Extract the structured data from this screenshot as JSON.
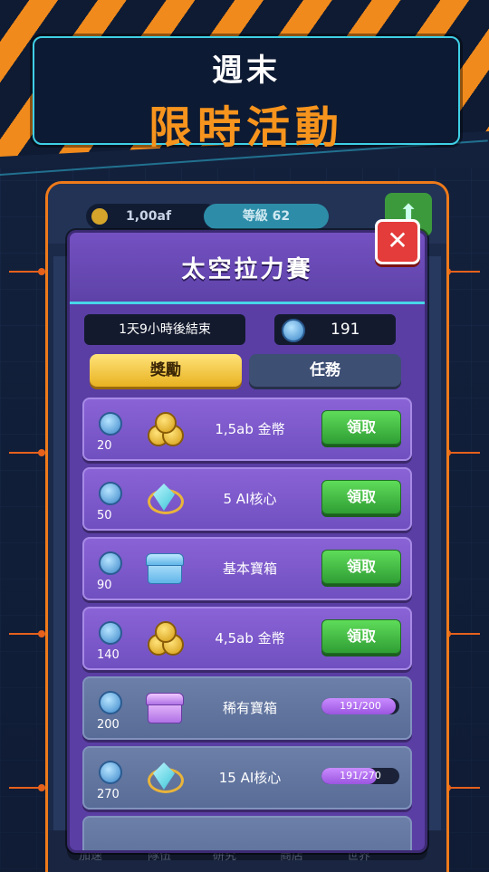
{
  "banner": {
    "line1": "週末",
    "line2": "限時活動"
  },
  "game": {
    "currency": "1,00af",
    "level": "等級 62",
    "nav": [
      "加速",
      "隊伍",
      "研究",
      "商店",
      "世界"
    ]
  },
  "dialog": {
    "title": "太空拉力賽",
    "close_label": "✕",
    "timer": "1天9小時後結束",
    "points": "191",
    "tabs": {
      "rewards": "獎勵",
      "tasks": "任務"
    },
    "rows": [
      {
        "points": "20",
        "label": "1,5ab 金幣",
        "icon": "coins-icon",
        "state": "claim",
        "button": "領取"
      },
      {
        "points": "50",
        "label": "5 AI核心",
        "icon": "gem-icon",
        "state": "claim",
        "button": "領取"
      },
      {
        "points": "90",
        "label": "基本寶箱",
        "icon": "blue-chest-icon",
        "state": "claim",
        "button": "領取"
      },
      {
        "points": "140",
        "label": "4,5ab 金幣",
        "icon": "coins-icon",
        "state": "claim",
        "button": "領取"
      },
      {
        "points": "200",
        "label": "稀有寶箱",
        "icon": "purple-chest-icon",
        "state": "progress",
        "progress": "191/200",
        "progress_fraction": 0.955
      },
      {
        "points": "270",
        "label": "15 AI核心",
        "icon": "gem-icon",
        "state": "progress",
        "progress": "191/270",
        "progress_fraction": 0.707
      }
    ]
  },
  "colors": {
    "accent_orange": "#f7941d",
    "claim_green": "#3fbf3f",
    "dialog_purple": "#5a3ea4",
    "close_red": "#e43b3b"
  }
}
